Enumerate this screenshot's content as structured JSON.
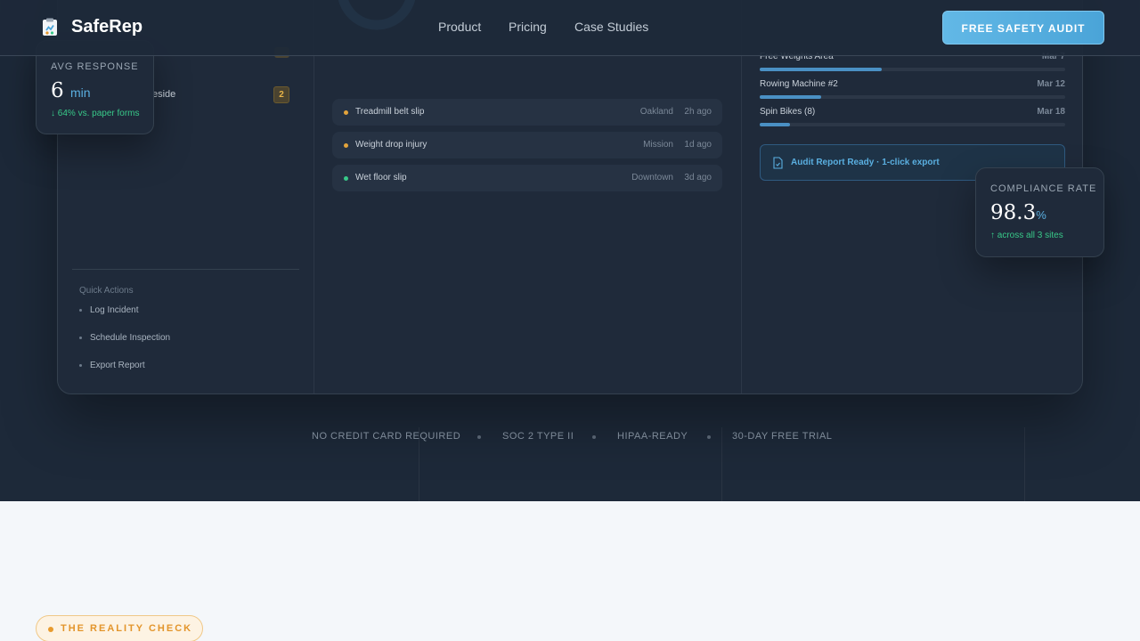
{
  "nav": {
    "brand": "SafeRep",
    "links": [
      "Product",
      "Pricing",
      "Case Studies"
    ],
    "cta": "FREE SAFETY AUDIT"
  },
  "dashboard": {
    "sites": [
      {
        "label": "eside",
        "count": "2"
      }
    ],
    "quick_actions": {
      "title": "Quick Actions",
      "items": [
        "Log Incident",
        "Schedule Inspection",
        "Export Report"
      ]
    },
    "incidents": [
      {
        "title": "Treadmill belt slip",
        "location": "Oakland",
        "time": "2h ago",
        "color": "#e3a33b"
      },
      {
        "title": "Weight drop injury",
        "location": "Mission",
        "time": "1d ago",
        "color": "#e3a33b"
      },
      {
        "title": "Wet floor slip",
        "location": "Downtown",
        "time": "3d ago",
        "color": "#38c989"
      }
    ],
    "equipment": [
      {
        "name": "Free Weights Area",
        "date": "Mar 7",
        "progress": 0.4
      },
      {
        "name": "Rowing Machine #2",
        "date": "Mar 12",
        "progress": 0.2
      },
      {
        "name": "Spin Bikes (8)",
        "date": "Mar 18",
        "progress": 0.1
      }
    ],
    "audit_banner": "Audit Report Ready · 1-click export"
  },
  "avg_response": {
    "label": "AVG RESPONSE",
    "value": "6",
    "unit": "min",
    "sub": "↓ 64% vs. paper forms"
  },
  "compliance": {
    "label": "COMPLIANCE RATE",
    "value": "98.3",
    "unit": "%",
    "sub": "↑ across all 3 sites"
  },
  "trust_items": [
    "NO CREDIT CARD REQUIRED",
    "SOC 2 TYPE II",
    "HIPAA-READY",
    "30-DAY FREE TRIAL"
  ],
  "reality_check": "THE REALITY CHECK",
  "colors": {
    "accent": "#5aafe0",
    "warning": "#e3a33b",
    "success": "#38c989",
    "hero_bg": "#1d2939"
  }
}
